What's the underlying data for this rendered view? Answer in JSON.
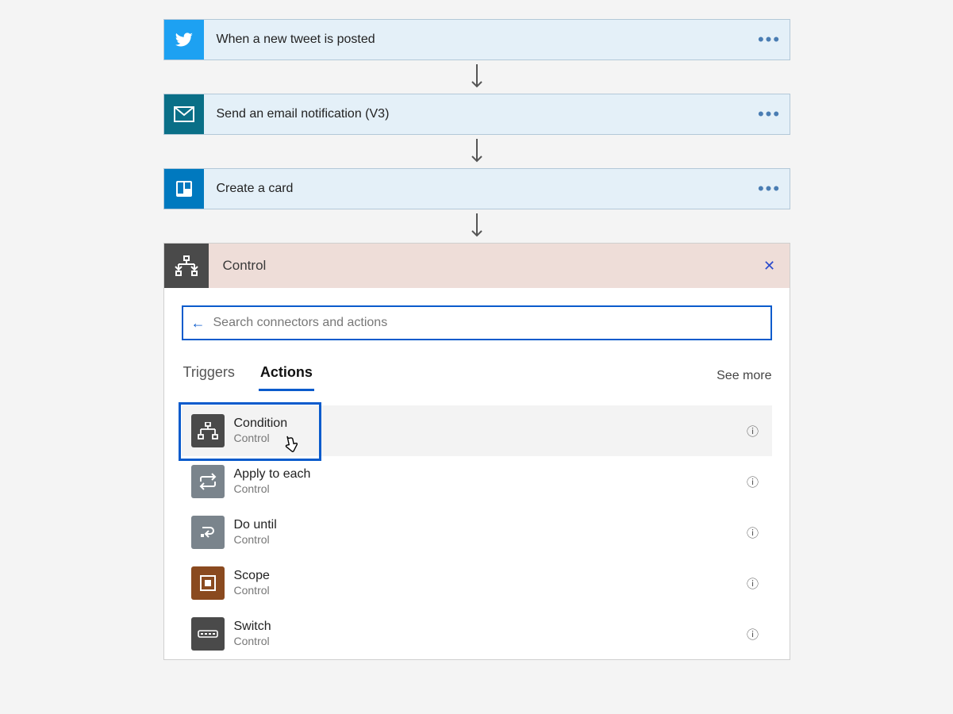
{
  "steps": [
    {
      "label": "When a new tweet is posted",
      "icon": "twitter-icon",
      "iconClass": "twitter"
    },
    {
      "label": "Send an email notification (V3)",
      "icon": "email-icon",
      "iconClass": "email"
    },
    {
      "label": "Create a card",
      "icon": "trello-icon",
      "iconClass": "trello"
    }
  ],
  "panel": {
    "title": "Control",
    "search_placeholder": "Search connectors and actions",
    "tabs": {
      "triggers": "Triggers",
      "actions": "Actions"
    },
    "see_more": "See more",
    "actions_list": [
      {
        "title": "Condition",
        "subtitle": "Control",
        "icon": "condition-icon",
        "iconClass": "dark",
        "highlighted": true
      },
      {
        "title": "Apply to each",
        "subtitle": "Control",
        "icon": "apply-icon",
        "iconClass": "gray"
      },
      {
        "title": "Do until",
        "subtitle": "Control",
        "icon": "dountil-icon",
        "iconClass": "gray"
      },
      {
        "title": "Scope",
        "subtitle": "Control",
        "icon": "scope-icon",
        "iconClass": "brown"
      },
      {
        "title": "Switch",
        "subtitle": "Control",
        "icon": "switch-icon",
        "iconClass": "dark"
      }
    ]
  }
}
